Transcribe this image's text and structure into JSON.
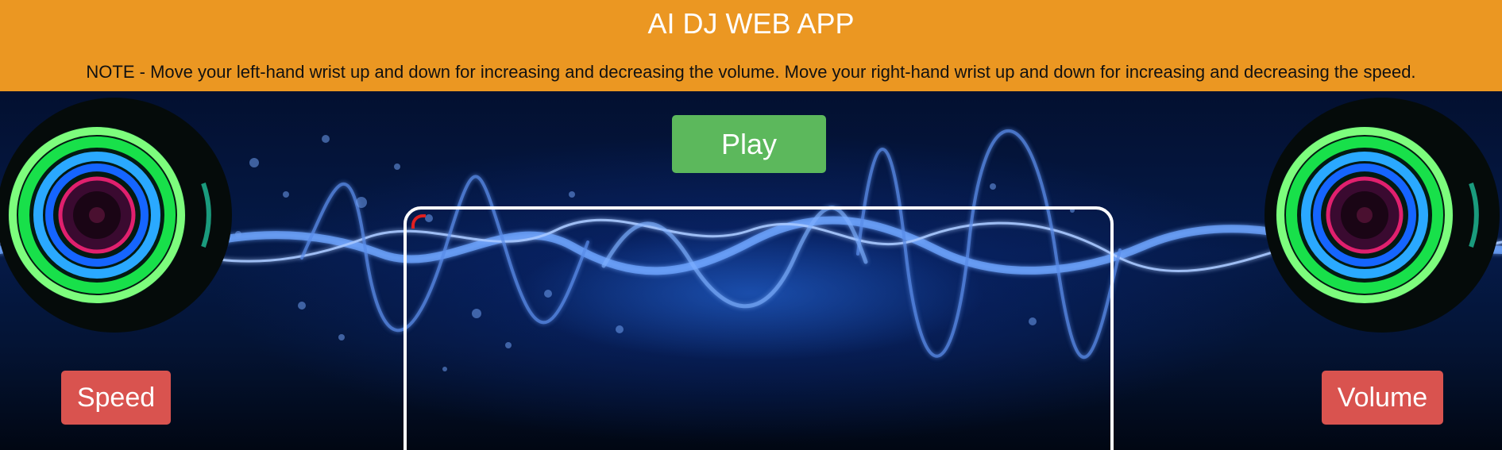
{
  "header": {
    "title": "AI DJ WEB APP",
    "note": "NOTE - Move your left-hand wrist up and down for increasing and decreasing the volume. Move your right-hand wrist up and down for increasing and decreasing the speed."
  },
  "controls": {
    "play_label": "Play",
    "speed_label": "Speed",
    "volume_label": "Volume"
  },
  "colors": {
    "header_bg": "#eb9722",
    "play_bg": "#5cb85c",
    "action_bg": "#d9534f",
    "background": "#051a48"
  },
  "icons": {
    "left_disc": "dj-turntable-icon",
    "right_disc": "dj-turntable-icon"
  }
}
